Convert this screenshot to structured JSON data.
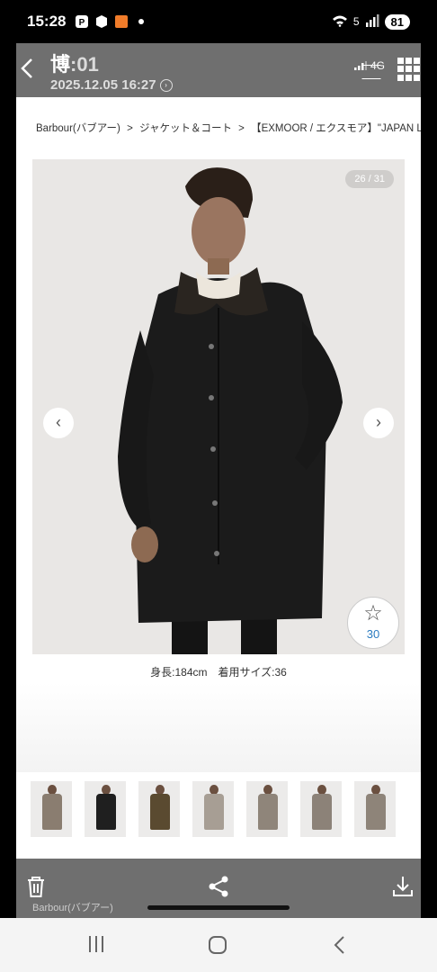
{
  "status_bar": {
    "time": "15:28",
    "battery": "81",
    "network": "5"
  },
  "viewer": {
    "sender_char": "博",
    "sender_suffix": ":01",
    "datetime": "2025.12.05 16:27",
    "inner_network": "4G"
  },
  "page": {
    "breadcrumb": [
      "Barbour(バブアー)",
      ">",
      "ジャケット＆コート",
      ">",
      "【EXMOOR / エクスモア】\"JAPAN LIMI"
    ],
    "counter": "26 / 31",
    "favorite_count": "30",
    "caption": "身長:184cm　着用サイズ:36",
    "thumbnails": [
      {
        "coat_color": "#8a7d70"
      },
      {
        "coat_color": "#1f1f1f"
      },
      {
        "coat_color": "#5a4a30"
      },
      {
        "coat_color": "#a79e94"
      },
      {
        "coat_color": "#8f857a"
      },
      {
        "coat_color": "#8c8278"
      },
      {
        "coat_color": "#8e8479"
      }
    ]
  },
  "toolbar": {
    "brand_label": "Barbour(バブアー)"
  },
  "colors": {
    "viewer_bar": "#6f6f6f",
    "link_blue": "#2a7bc0"
  },
  "icons": [
    "back-arrow-icon",
    "info-icon",
    "grid-icon",
    "scan-icon",
    "star-icon",
    "chevron-left-icon",
    "chevron-right-icon",
    "edit-icon",
    "trash-icon",
    "share-icon",
    "download-icon"
  ]
}
